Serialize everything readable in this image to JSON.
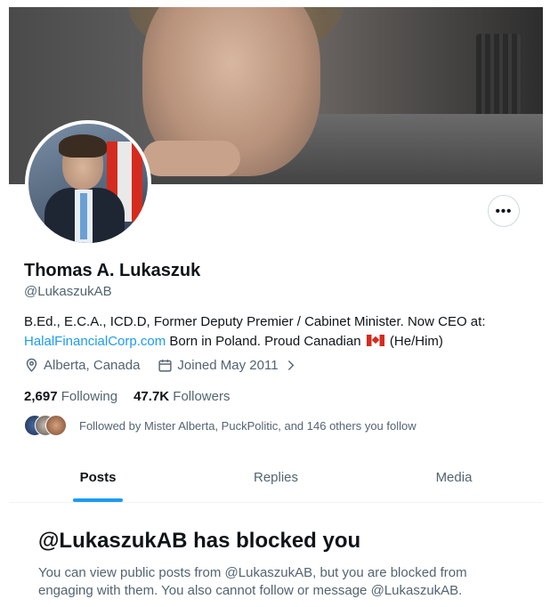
{
  "profile": {
    "name": "Thomas A. Lukaszuk",
    "handle": "@LukaszukAB",
    "bio_text": "B.Ed., E.C.A., ICD.D, Former Deputy Premier / Cabinet Minister. Now CEO at:",
    "bio_link": "HalalFinancialCorp.com",
    "bio_after_link": "Born in Poland. Proud Canadian",
    "bio_pronouns": "(He/Him)",
    "location": "Alberta, Canada",
    "joined": "Joined May 2011",
    "following_count": "2,697",
    "following_label": "Following",
    "followers_count": "47.7K",
    "followers_label": "Followers",
    "followed_by": "Followed by Mister Alberta, PuckPolitic, and 146 others you follow"
  },
  "more_button": "•••",
  "tabs": [
    {
      "label": "Posts"
    },
    {
      "label": "Replies"
    },
    {
      "label": "Media"
    }
  ],
  "blocked": {
    "title": "@LukaszukAB has blocked you",
    "text": "You can view public posts from @LukaszukAB, but you are blocked from engaging with them. You also cannot follow or message @LukaszukAB."
  },
  "colors": {
    "accent": "#1d9bf0",
    "text": "#0f1419",
    "muted": "#536471"
  }
}
